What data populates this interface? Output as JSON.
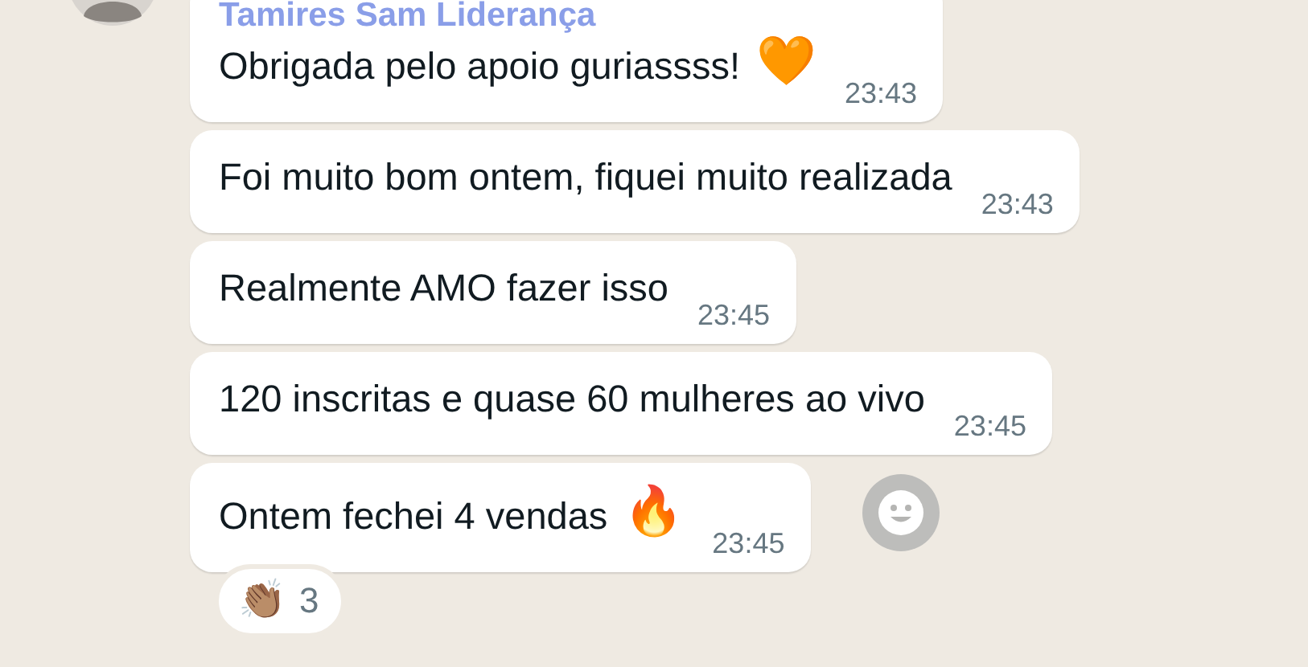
{
  "messages": [
    {
      "avatar": true,
      "sender": "Tamires Sam Liderança",
      "text": "Obrigada pelo apoio guriassss!",
      "emoji": "🧡",
      "time": "23:43"
    },
    {
      "text": "Foi muito bom ontem, fiquei muito realizada",
      "time": "23:43"
    },
    {
      "text": "Realmente AMO fazer isso",
      "time": "23:45"
    },
    {
      "text": "120 inscritas e quase 60 mulheres ao vivo",
      "time": "23:45"
    },
    {
      "text": "Ontem fechei 4 vendas",
      "emoji": "🔥",
      "time": "23:45",
      "react_button": true,
      "reactions": [
        {
          "emoji": "👏🏽",
          "count": "3"
        }
      ]
    }
  ]
}
